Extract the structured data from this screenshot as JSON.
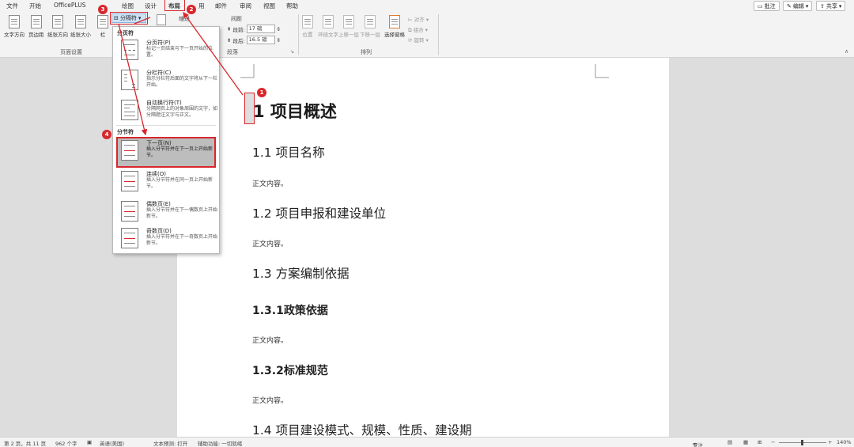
{
  "tabs": [
    {
      "label": "文件",
      "active": false
    },
    {
      "label": "开始",
      "active": false
    },
    {
      "label": "OfficePLUS",
      "active": false
    },
    {
      "label": "绘图",
      "active": false
    },
    {
      "label": "设计",
      "active": false
    },
    {
      "label": "布局",
      "active": true
    },
    {
      "label": "用",
      "active": false
    },
    {
      "label": "邮件",
      "active": false
    },
    {
      "label": "审阅",
      "active": false
    },
    {
      "label": "视图",
      "active": false
    },
    {
      "label": "帮助",
      "active": false
    }
  ],
  "top_right": {
    "comments": "批注",
    "edit": "编辑",
    "share": "共享"
  },
  "ribbon": {
    "page_setup": {
      "buttons": [
        "文字方向",
        "页边距",
        "纸张方向",
        "纸张大小",
        "栏"
      ],
      "group_label": "页面设置"
    },
    "breaks_button": "分隔符",
    "paragraph": {
      "indent_label": "缩进",
      "spacing_label": "间距",
      "spacing_before_label": "段前:",
      "spacing_before_value": "17 磅",
      "spacing_after_label": "段后:",
      "spacing_after_value": "16.5 磅",
      "group_label": "段落"
    },
    "arrange": {
      "buttons": [
        "位置",
        "环绕文字",
        "上移一层",
        "下移一层",
        "选择窗格"
      ],
      "small_buttons": [
        "对齐",
        "组合",
        "旋转"
      ],
      "group_label": "排列"
    }
  },
  "dropdown": {
    "page_breaks_header": "分页符",
    "section_breaks_header": "分节符",
    "items": [
      {
        "title": "分页符(P)",
        "desc": "标记一页结束与下一页开始的位置。",
        "highlighted": false
      },
      {
        "title": "分栏符(C)",
        "desc": "指示分栏符后面的文字将从下一栏开始。",
        "highlighted": false
      },
      {
        "title": "自动换行符(T)",
        "desc": "分隔网页上的对象周围的文字，如分隔题注文字与正文。",
        "highlighted": false
      },
      {
        "title": "下一页(N)",
        "desc": "插入分节符并在下一页上开始新节。",
        "highlighted": true
      },
      {
        "title": "连续(O)",
        "desc": "插入分节符并在同一页上开始新节。",
        "highlighted": false
      },
      {
        "title": "偶数页(E)",
        "desc": "插入分节符并在下一偶数页上开始新节。",
        "highlighted": false
      },
      {
        "title": "奇数页(D)",
        "desc": "插入分节符并在下一奇数页上开始新节。",
        "highlighted": false
      }
    ]
  },
  "annotations": [
    "1",
    "2",
    "3",
    "4"
  ],
  "document": {
    "h1": "1  项目概述",
    "h2_1": "1.1  项目名称",
    "body_1": "正文内容。",
    "h2_2": "1.2  项目申报和建设单位",
    "body_2": "正文内容。",
    "h2_3": "1.3  方案编制依据",
    "h3_1": "1.3.1政策依据",
    "body_3": "正文内容。",
    "h3_2": "1.3.2标准规范",
    "body_4": "正文内容。",
    "h2_4": "1.4  项目建设模式、规模、性质、建设期"
  },
  "status": {
    "page": "第 2 页，共 11 页",
    "words": "962 个字",
    "language": "英语(美国)",
    "prediction": "文本预测: 打开",
    "accessibility": "辅助功能: 一切就绪",
    "focus": "专注",
    "zoom": "140%"
  },
  "colors": {
    "accent_red": "#d9262c",
    "ribbon_bg": "#f3f3f3",
    "canvas_bg": "#dddddd"
  }
}
